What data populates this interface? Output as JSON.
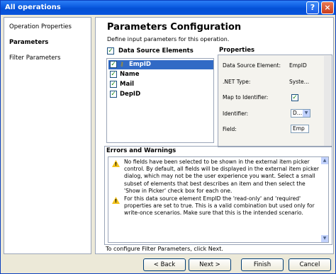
{
  "window": {
    "title": "All operations",
    "help": "?",
    "close": "×"
  },
  "nav": {
    "items": [
      "Operation Properties",
      "Parameters",
      "Filter Parameters"
    ]
  },
  "main": {
    "heading": "Parameters Configuration",
    "subheading": "Define input parameters for this operation.",
    "data_source_label": "Data Source Elements",
    "elements": [
      "EmpID",
      "Name",
      "Mail",
      "DepID"
    ],
    "properties_title": "Properties",
    "properties": [
      {
        "name": "Data Source Element:",
        "value": "EmpID"
      },
      {
        "name": ".NET Type:",
        "value": "Syste…"
      },
      {
        "name": "Map to Identifier:",
        "value": ""
      },
      {
        "name": "Identifier:",
        "value": "D…"
      },
      {
        "name": "Field:",
        "value": "Emp"
      }
    ],
    "errors_title": "Errors and Warnings",
    "messages": [
      "No fields have been selected to be shown in the external item picker control. By default, all fields will be displayed in the external item picker dialog, which may not be the user experience you want. Select a small subset of elements that best describes an item and then select the 'Show in Picker' check box for each one.",
      "For this data source element EmpID the 'read-only' and 'required' properties are set to true. This is a valid combination but used only for write-once scenarios. Make sure that this is the intended scenario."
    ],
    "footer_note": "To configure Filter Parameters, click Next."
  },
  "buttons": {
    "back": "< Back",
    "next": "Next >",
    "finish": "Finish",
    "cancel": "Cancel"
  },
  "colors": {
    "titlebar": "#0a5ae0",
    "selection": "#316ac5",
    "window_bg": "#ece9d8"
  }
}
